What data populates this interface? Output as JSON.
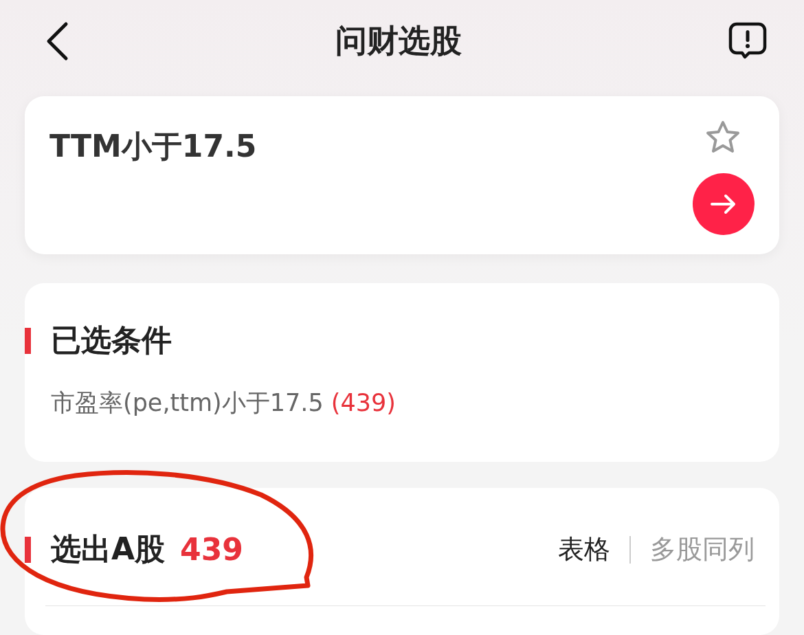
{
  "header": {
    "title": "问财选股"
  },
  "query": {
    "value": "TTM小于17.5",
    "starred": false
  },
  "conditions": {
    "title": "已选条件",
    "items": [
      {
        "text": "市盈率(pe,ttm)小于17.5",
        "count": "(439)"
      }
    ]
  },
  "results": {
    "title": "选出A股",
    "count": "439",
    "views": [
      {
        "label": "表格",
        "selected": true
      },
      {
        "label": "多股同列",
        "selected": false
      }
    ]
  }
}
